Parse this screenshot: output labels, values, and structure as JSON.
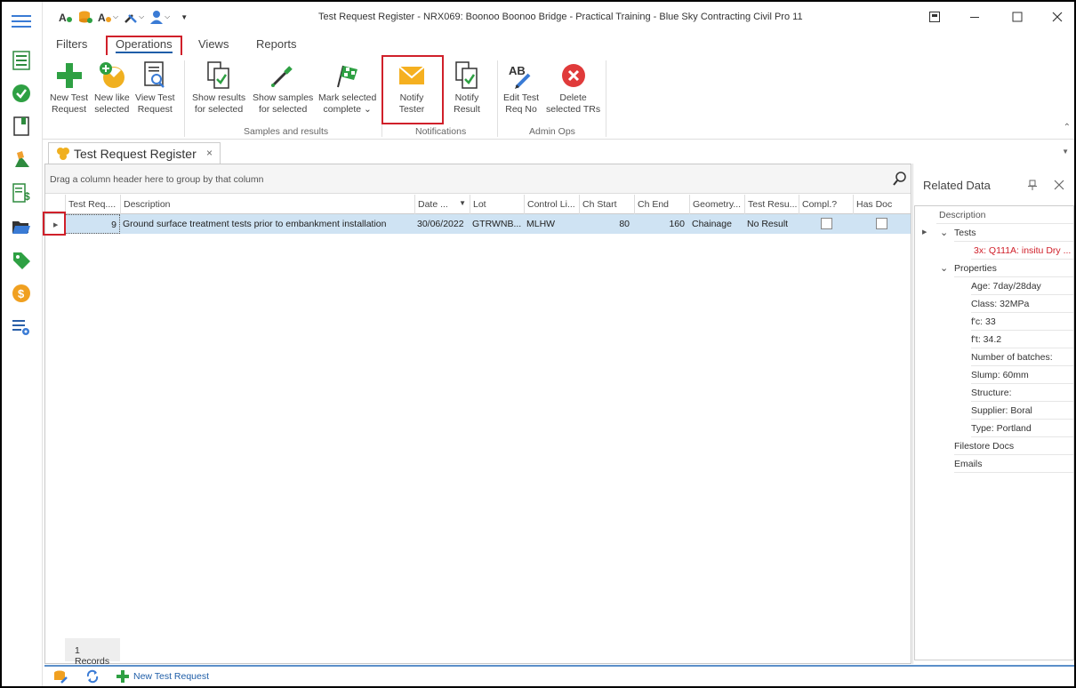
{
  "window": {
    "title": "Test Request Register - NRX069: Boonoo Boonoo Bridge - Practical Training - Blue Sky Contracting Civil Pro 11"
  },
  "ribbon": {
    "tabs": [
      "Filters",
      "Operations",
      "Views",
      "Reports"
    ],
    "active_tab": "Operations",
    "buttons": {
      "new_test_request": [
        "New Test",
        "Request"
      ],
      "new_like_selected": [
        "New like",
        "selected"
      ],
      "view_test_request": [
        "View Test",
        "Request"
      ],
      "show_results": [
        "Show results",
        "for selected"
      ],
      "show_samples": [
        "Show samples",
        "for selected"
      ],
      "mark_complete": [
        "Mark selected",
        "complete ⌄"
      ],
      "notify_tester": [
        "Notify",
        "Tester"
      ],
      "notify_result": [
        "Notify",
        "Result"
      ],
      "edit_test_req_no": [
        "Edit Test",
        "Req No"
      ],
      "delete_selected": [
        "Delete",
        "selected TRs"
      ]
    },
    "groups": {
      "samples_results": "Samples and results",
      "notifications": "Notifications",
      "admin_ops": "Admin Ops"
    }
  },
  "document_tab": {
    "label": "Test Request Register",
    "close": "×"
  },
  "grid": {
    "group_hint": "Drag a column header here to group by that column",
    "columns": [
      "Test Req....",
      "Description",
      "Date ...",
      "Lot",
      "Control Li...",
      "Ch Start",
      "Ch End",
      "Geometry...",
      "Test Resu...",
      "Compl.?",
      "Has Doc"
    ],
    "rows": [
      {
        "test_req": "9",
        "description": "Ground surface treatment tests prior to embankment installation",
        "date": "30/06/2022",
        "lot": "GTRWNB...",
        "control_line": "MLHW",
        "ch_start": "80",
        "ch_end": "160",
        "geometry": "Chainage",
        "test_result": "No Result"
      }
    ],
    "records_label": "1 Records"
  },
  "related_data": {
    "title": "Related Data",
    "column": "Description",
    "tests_label": "Tests",
    "test_item": "3x: Q111A: insitu Dry ...",
    "properties_label": "Properties",
    "properties": [
      "Age: 7day/28day",
      "Class: 32MPa",
      "f'c: 33",
      "f't: 34.2",
      "Number of batches:",
      "Slump: 60mm",
      "Structure:",
      "Supplier: Boral",
      "Type: Portland"
    ],
    "filestore": "Filestore Docs",
    "emails": "Emails"
  },
  "bottombar": {
    "new_test_request": "New Test Request"
  },
  "colors": {
    "accent": "#1f5ea8",
    "highlight_red": "#d0202a",
    "row_selected": "#cfe3f3",
    "test_item_red": "#d0202a"
  }
}
